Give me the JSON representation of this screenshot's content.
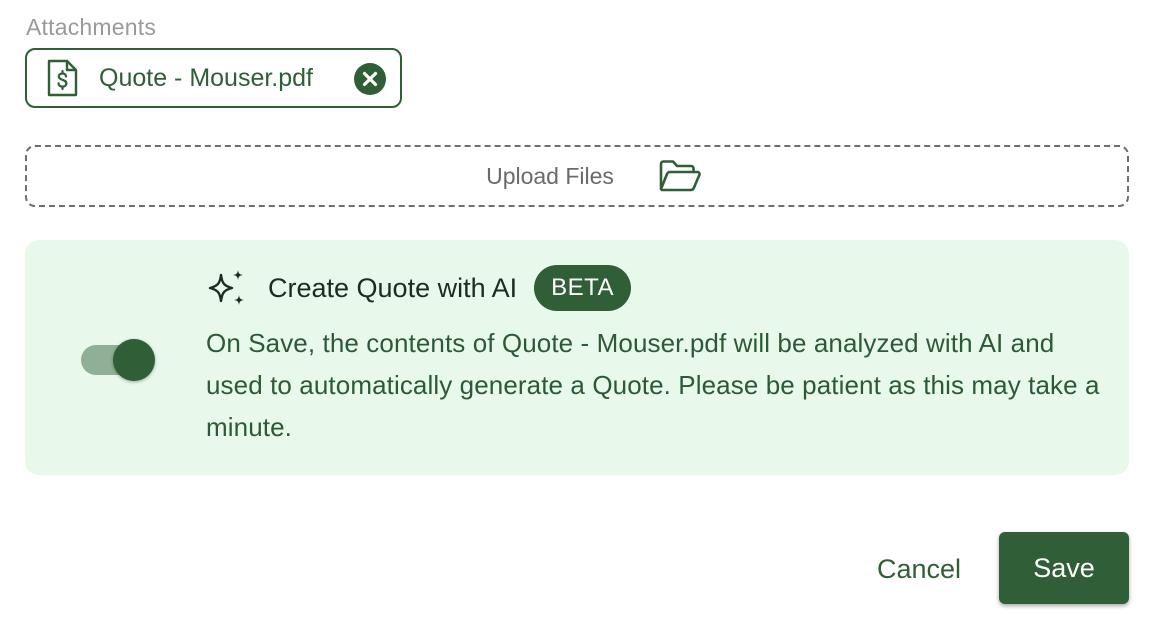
{
  "attachments": {
    "label": "Attachments",
    "items": [
      {
        "name": "Quote - Mouser.pdf",
        "icon": "file-dollar-icon",
        "remove_icon": "close-circle-icon"
      }
    ]
  },
  "upload": {
    "label": "Upload Files",
    "icon": "folder-open-icon"
  },
  "ai_panel": {
    "icon": "sparkle-icon",
    "title": "Create Quote with AI",
    "badge": "BETA",
    "description": "On Save, the contents of Quote - Mouser.pdf will be analyzed with AI and used to automatically generate a Quote. Please be patient as this may take a minute.",
    "toggle_on": true
  },
  "actions": {
    "cancel_label": "Cancel",
    "save_label": "Save"
  },
  "colors": {
    "primary": "#2f5e37",
    "panel_background": "#e8f9ec",
    "muted_label": "#9a9a9a",
    "toggle_track": "#8fb096"
  }
}
